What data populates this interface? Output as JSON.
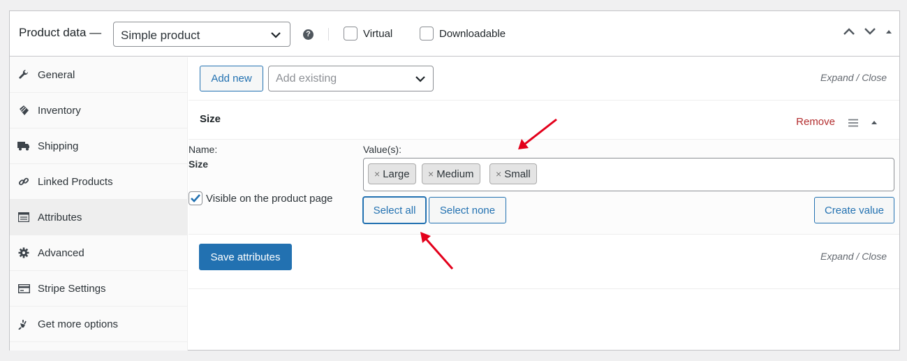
{
  "header": {
    "title": "Product data —",
    "product_type": "Simple product",
    "help_icon": "?",
    "virtual_label": "Virtual",
    "downloadable_label": "Downloadable"
  },
  "sidebar": {
    "items": [
      {
        "label": "General",
        "icon": "wrench-icon"
      },
      {
        "label": "Inventory",
        "icon": "tag-icon"
      },
      {
        "label": "Shipping",
        "icon": "truck-icon"
      },
      {
        "label": "Linked Products",
        "icon": "link-icon"
      },
      {
        "label": "Attributes",
        "icon": "list-icon",
        "active": true
      },
      {
        "label": "Advanced",
        "icon": "gear-icon"
      },
      {
        "label": "Stripe Settings",
        "icon": "card-icon"
      },
      {
        "label": "Get more options",
        "icon": "plug-icon"
      }
    ]
  },
  "toolbar": {
    "add_new": "Add new",
    "add_existing_placeholder": "Add existing",
    "expand_close": "Expand / Close"
  },
  "attribute": {
    "title": "Size",
    "remove": "Remove",
    "name_label": "Name:",
    "name_value": "Size",
    "visible_label": "Visible on the product page",
    "visible_checked": true,
    "values_label": "Value(s):",
    "values": [
      "Large",
      "Medium",
      "Small"
    ],
    "select_all": "Select all",
    "select_none": "Select none",
    "create_value": "Create value"
  },
  "footer": {
    "save_attributes": "Save attributes",
    "expand_close": "Expand / Close"
  },
  "colors": {
    "accent": "#2271b1",
    "danger": "#b32d2e",
    "annotation_arrow": "#e3001b"
  }
}
